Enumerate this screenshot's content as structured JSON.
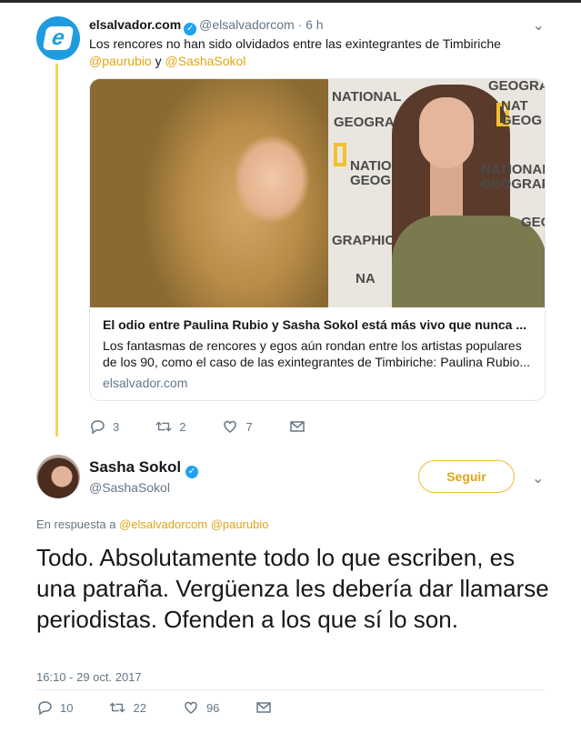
{
  "parent_tweet": {
    "display_name": "elsalvador.com",
    "handle": "@elsalvadorcom",
    "time": "· 6 h",
    "text": "Los rencores no han sido olvidados entre las exintegrantes de Timbiriche",
    "mention_1": "@paurubio",
    "conjunction": "y",
    "mention_2": "@SashaSokol",
    "card": {
      "title": "El odio entre Paulina Rubio y Sasha Sokol está más vivo que nunca ...",
      "description": "Los fantasmas de rencores y egos aún rondan entre los artistas populares de los 90, como el caso de las exintegrantes de Timbiriche: Paulina Rubio...",
      "domain": "elsalvador.com",
      "image_signage": [
        "NATIONAL",
        "GEOGRAPHIC",
        "NAT",
        "GEOG",
        "NATIONAL",
        "GEOGRAPHIC",
        "NATIONAL",
        "GEOGRAPHIC",
        "NATIONAL",
        "GRAPHIC",
        "NA",
        "GEOG"
      ]
    },
    "actions": {
      "reply_count": "3",
      "retweet_count": "2",
      "like_count": "7"
    }
  },
  "main_tweet": {
    "display_name": "Sasha Sokol",
    "handle": "@SashaSokol",
    "follow_label": "Seguir",
    "reply_prefix": "En respuesta a",
    "reply_mention_1": "@elsalvadorcom",
    "reply_mention_2": "@paurubio",
    "text": "Todo. Absolutamente todo lo que escriben, es una patraña. Vergüenza les debería dar llamarse periodistas. Ofenden a los que sí lo son.",
    "timestamp": "16:10 - 29 oct. 2017",
    "actions": {
      "reply_count": "10",
      "retweet_count": "22",
      "like_count": "96"
    }
  },
  "colors": {
    "accent": "#e0a516",
    "thread_line": "#f5d25a",
    "muted": "#657786",
    "verified": "#1da1f2"
  },
  "icons": [
    "reply-icon",
    "retweet-icon",
    "like-icon",
    "message-icon",
    "verified-icon",
    "chevron-down-icon"
  ]
}
